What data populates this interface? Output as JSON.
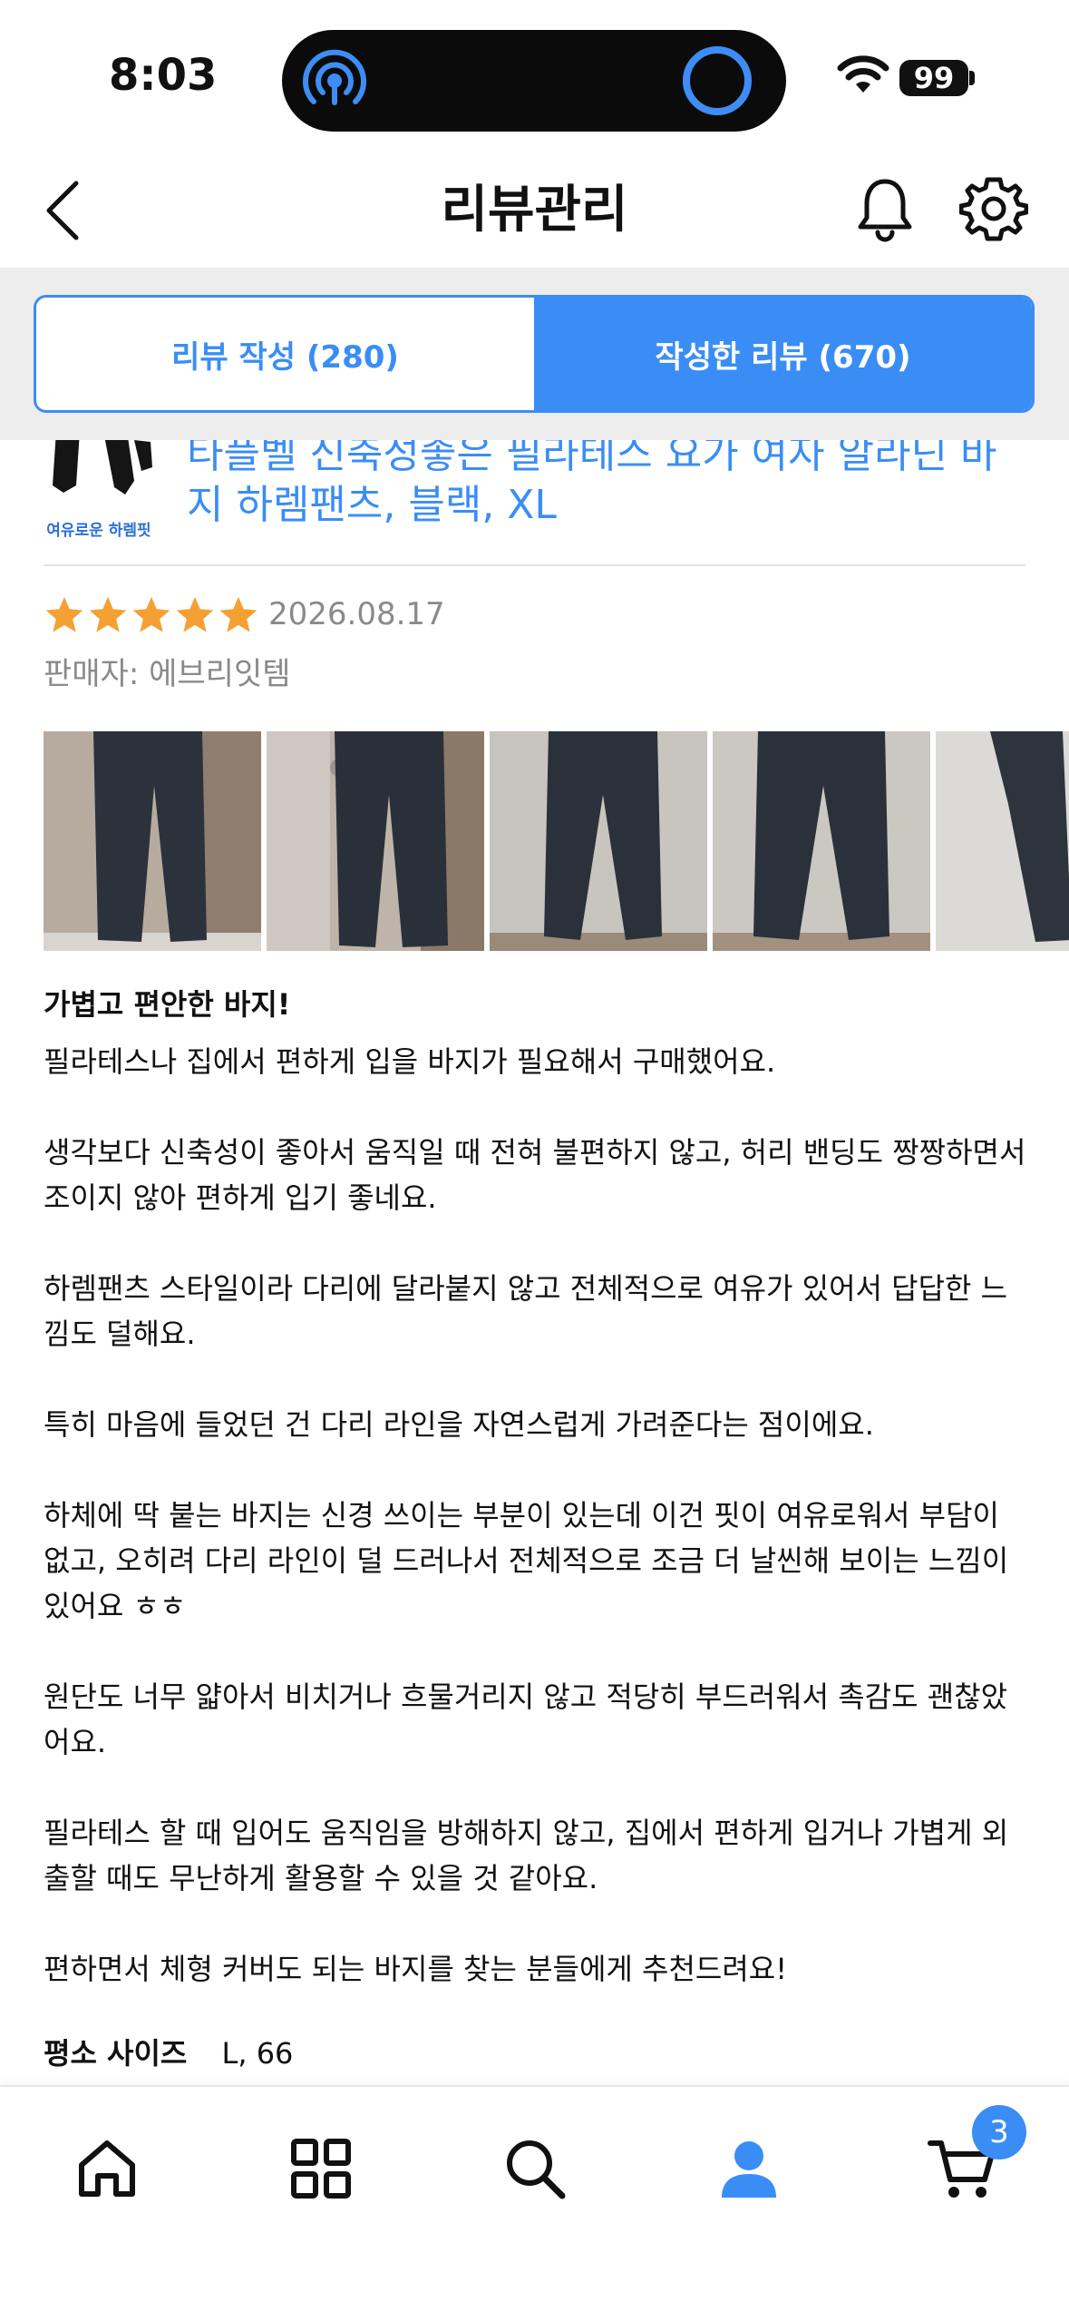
{
  "status_bar": {
    "time": "8:03",
    "battery": "99"
  },
  "header": {
    "title": "리뷰관리"
  },
  "tabs": [
    {
      "label": "리뷰 작성 (280)",
      "active": false
    },
    {
      "label": "작성한 리뷰 (670)",
      "active": true
    }
  ],
  "product": {
    "thumb_label": "여유로운 하렘핏",
    "name": "타플벨 신축성좋은 필라테스 요가 여자 알라딘 바지 하렘팬츠, 블랙, XL"
  },
  "review": {
    "rating": 5,
    "date": "2026.08.17",
    "seller": "판매자: 에브리잇템",
    "photo_count": 5,
    "title": "가볍고 편안한 바지!",
    "paragraphs": [
      "필라테스나 집에서 편하게 입을 바지가 필요해서 구매했어요.",
      " 생각보다 신축성이 좋아서 움직일 때 전혀 불편하지 않고, 허리 밴딩도 짱짱하면서 조이지 않아 편하게 입기 좋네요.",
      " 하렘팬츠 스타일이라 다리에 달라붙지 않고 전체적으로 여유가 있어서 답답한 느낌도 덜해요.",
      " 특히 마음에 들었던 건 다리 라인을 자연스럽게 가려준다는 점이에요.",
      " 하체에 딱 붙는 바지는 신경 쓰이는 부분이 있는데 이건 핏이 여유로워서 부담이 없고, 오히려 다리 라인이 덜 드러나서 전체적으로 조금 더 날씬해 보이는 느낌이 있어요 ㅎㅎ",
      " 원단도 너무 얇아서 비치거나 흐물거리지 않고 적당히 부드러워서 촉감도 괜찮았어요.",
      " 필라테스 할 때 입어도 움직임을 방해하지 않고, 집에서 편하게 입거나 가볍게 외출할 때도 무난하게 활용할 수 있을 것 같아요.",
      " 편하면서 체형 커버도 되는 바지를 찾는 분들에게 추천드려요!"
    ],
    "size_label": "평소 사이즈",
    "size_value": "L, 66"
  },
  "bottom_nav": {
    "items": [
      "home-icon",
      "categories-icon",
      "search-icon",
      "profile-icon",
      "cart-icon"
    ],
    "cart_badge": "3"
  },
  "colors": {
    "accent": "#3a8df5",
    "star": "#f5a032",
    "muted": "#8a8a8a"
  }
}
